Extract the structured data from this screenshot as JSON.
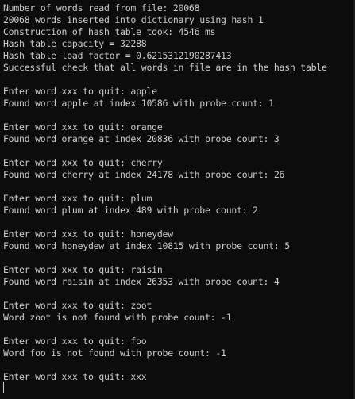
{
  "console": {
    "lines": [
      "Number of words read from file: 20068",
      "20068 words inserted into dictionary using hash 1",
      "Construction of hash table took: 4546 ms",
      "Hash table capacity = 32288",
      "Hash table load factor = 0.6215312190287413",
      "Successful check that all words in file are in the hash table",
      "",
      "Enter word xxx to quit: apple",
      "Found word apple at index 10586 with probe count: 1",
      "",
      "Enter word xxx to quit: orange",
      "Found word orange at index 20836 with probe count: 3",
      "",
      "Enter word xxx to quit: cherry",
      "Found word cherry at index 24178 with probe count: 26",
      "",
      "Enter word xxx to quit: plum",
      "Found word plum at index 489 with probe count: 2",
      "",
      "Enter word xxx to quit: honeydew",
      "Found word honeydew at index 10815 with probe count: 5",
      "",
      "Enter word xxx to quit: raisin",
      "Found word raisin at index 26353 with probe count: 4",
      "",
      "Enter word xxx to quit: zoot",
      "Word zoot is not found with probe count: -1",
      "",
      "Enter word xxx to quit: foo",
      "Word foo is not found with probe count: -1",
      "",
      "Enter word xxx to quit: xxx"
    ]
  }
}
